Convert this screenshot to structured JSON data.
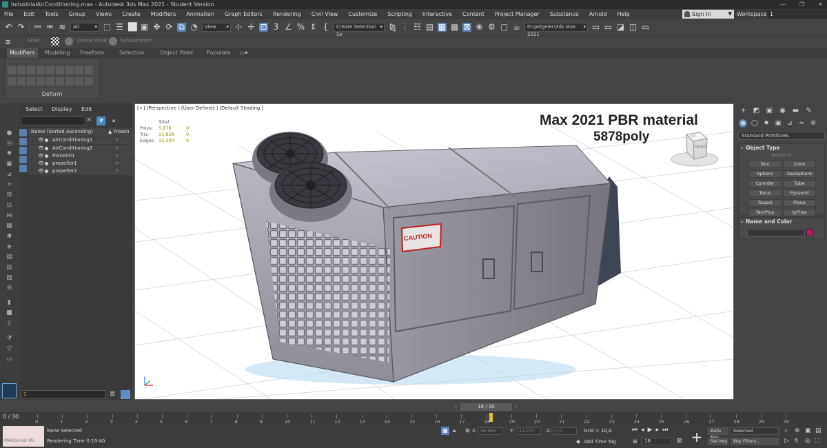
{
  "window": {
    "title": "IndustrialAirConditioning.max - Autodesk 3ds Max 2021 - Student Version"
  },
  "menu": [
    "File",
    "Edit",
    "Tools",
    "Group",
    "Views",
    "Create",
    "Modifiers",
    "Animation",
    "Graph Editors",
    "Rendering",
    "Civil View",
    "Customize",
    "Scripting",
    "Interactive",
    "Content",
    "Project Manager",
    "Substance",
    "Arnold",
    "Help"
  ],
  "account": {
    "signin": "Sign In",
    "workspaces_label": "Workspaces:",
    "workspaces_value": "1"
  },
  "toolbar": {
    "selection_filter": "All",
    "ref_coord": "View",
    "named_selection": "Create Selection Se",
    "project_path": "D:\\pelgeler\\3ds Max 2021"
  },
  "row2": {
    "item1": "Shell",
    "item2": "Center Pivot",
    "item3": "TurboSmooth"
  },
  "ribbon": {
    "tabs": [
      "Modifiers",
      "Modeling",
      "Freeform",
      "Selection",
      "Object Paint",
      "Populate"
    ],
    "panel_label": "Deform"
  },
  "scene_explorer": {
    "tabs": [
      "Select",
      "Display",
      "Edit"
    ],
    "col_name": "Name (Sorted Ascending)",
    "col_frozen": "▲ Frozen",
    "objects": [
      "AirConditioning1",
      "AirConditioning2",
      "Plane001",
      "propeller1",
      "propeller2"
    ],
    "layer_value": "1"
  },
  "viewport": {
    "label": "[+] [Perspective ] [User Defined ] [Default Shading ]",
    "stats": {
      "header": "Total",
      "rows": [
        {
          "k": "Polys:",
          "v": "5,878",
          "v2": "0"
        },
        {
          "k": "Tris:",
          "v": "11,828",
          "v2": "0"
        },
        {
          "k": "Edges:",
          "v": "12,330",
          "v2": "0"
        }
      ]
    },
    "annotation_line1": "Max 2021 PBR material",
    "annotation_line2": "5878poly",
    "viewcube_top": "TOP",
    "viewcube_front": "FRONT",
    "caution": "CAUTION"
  },
  "command_panel": {
    "category": "Standard Primitives",
    "object_type_title": "Object Type",
    "autogrid": "AutoGrid",
    "primitives": [
      "Box",
      "Cone",
      "Sphere",
      "GeoSphere",
      "Cylinder",
      "Tube",
      "Torus",
      "Pyramid",
      "Teapot",
      "Plane",
      "TextPlus",
      "tyFlow"
    ],
    "name_color_title": "Name and Color",
    "color": "#c0186e"
  },
  "timeline": {
    "frame_slider": "18 / 30",
    "range_label": "0 / 30",
    "ticks": [
      "0",
      "1",
      "2",
      "3",
      "4",
      "5",
      "6",
      "7",
      "8",
      "9",
      "10",
      "11",
      "12",
      "13",
      "14",
      "15",
      "16",
      "17",
      "18",
      "19",
      "20",
      "21",
      "22",
      "23",
      "24",
      "25",
      "26",
      "27",
      "28",
      "29",
      "30"
    ]
  },
  "status": {
    "maxscript": "MAXScript Mi:",
    "selection": "None Selected",
    "render_time": "Rendering Time  0:19:40",
    "x_label": "X:",
    "x_value": "96,065",
    "y_label": "Y:",
    "y_value": "11,271",
    "z_label": "Z:",
    "z_value": "0,0",
    "grid": "Grid = 10,0",
    "add_time_tag": "Add Time Tag",
    "frame_value": "18",
    "auto_key": "Auto Key",
    "selected": "Selected",
    "set_key": "Set Key",
    "key_filters": "Key Filters..."
  }
}
